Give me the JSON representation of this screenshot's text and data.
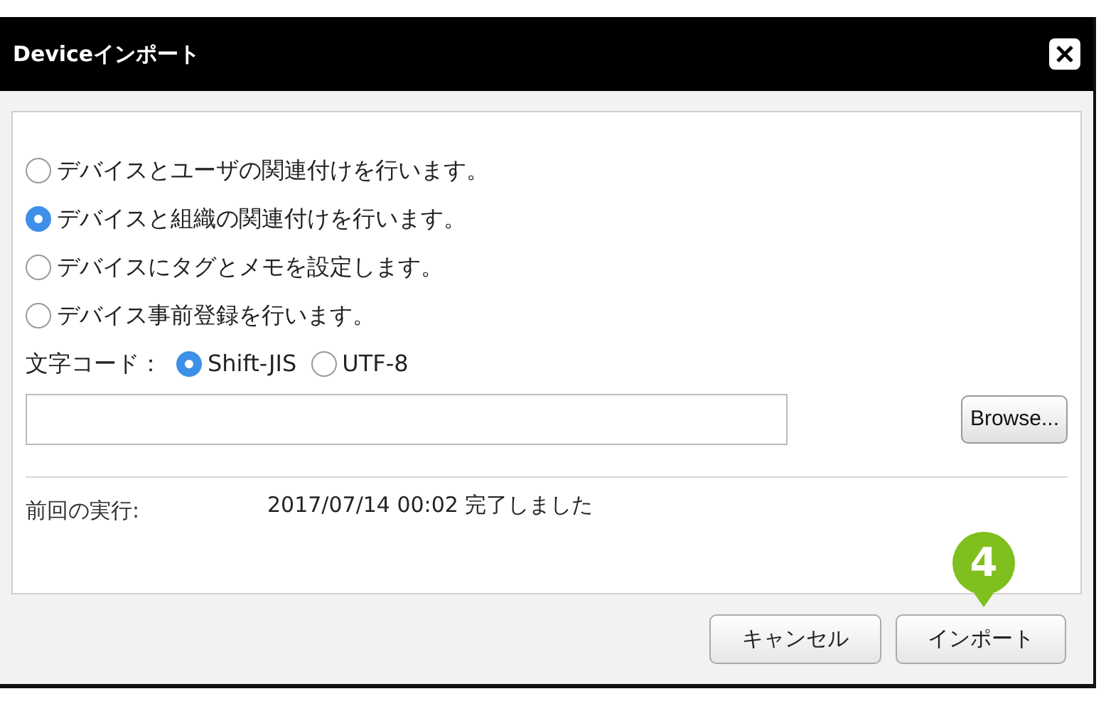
{
  "window": {
    "title": "Deviceインポート"
  },
  "modes": [
    {
      "label": "デバイスとユーザの関連付けを行います。",
      "selected": false
    },
    {
      "label": "デバイスと組織の関連付けを行います。",
      "selected": true
    },
    {
      "label": "デバイスにタグとメモを設定します。",
      "selected": false
    },
    {
      "label": "デバイス事前登録を行います。",
      "selected": false
    }
  ],
  "charset": {
    "label": "文字コード：",
    "options": [
      {
        "label": "Shift-JIS",
        "selected": true
      },
      {
        "label": "UTF-8",
        "selected": false
      }
    ]
  },
  "browse_button": "Browse...",
  "last_run": {
    "label": "前回の実行:",
    "value": "2017/07/14 00:02 完了しました"
  },
  "step_badge": "4",
  "buttons": [
    "キャンセル",
    "インポート"
  ]
}
